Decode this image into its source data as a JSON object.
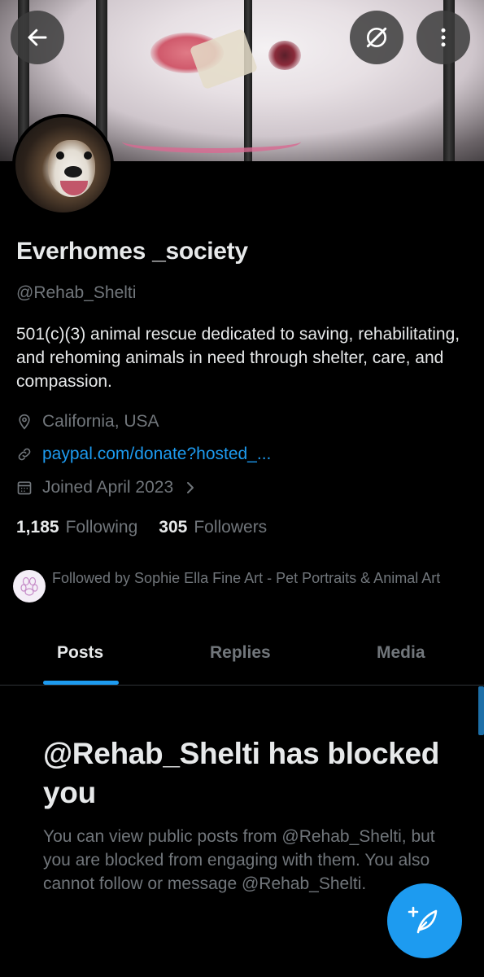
{
  "header": {
    "back_icon": "arrow-left-icon",
    "grok_icon": "grok-icon",
    "more_icon": "more-vertical-icon"
  },
  "profile": {
    "display_name": "Everhomes _society",
    "handle": "@Rehab_Shelti",
    "bio": "501(c)(3) animal rescue dedicated to saving, rehabilitating, and rehoming animals in need through shelter, care, and compassion.",
    "location": "California, USA",
    "website": "paypal.com/donate?hosted_...",
    "joined": "Joined April 2023",
    "following_count": "1,185",
    "following_label": "Following",
    "followers_count": "305",
    "followers_label": "Followers",
    "followed_by": "Followed by Sophie Ella Fine Art - Pet Portraits & Animal Art"
  },
  "tabs": [
    {
      "label": "Posts",
      "active": true
    },
    {
      "label": "Replies",
      "active": false
    },
    {
      "label": "Media",
      "active": false
    }
  ],
  "blocked": {
    "title": "@Rehab_Shelti has blocked you",
    "body": "You can view public posts from @Rehab_Shelti, but you are blocked from engaging with them. You also cannot follow or message @Rehab_Shelti."
  },
  "fab": {
    "icon": "compose-post-icon"
  },
  "colors": {
    "accent": "#1d9bf0",
    "background": "#000000",
    "text_primary": "#e7e9ea",
    "text_secondary": "#71767b"
  }
}
